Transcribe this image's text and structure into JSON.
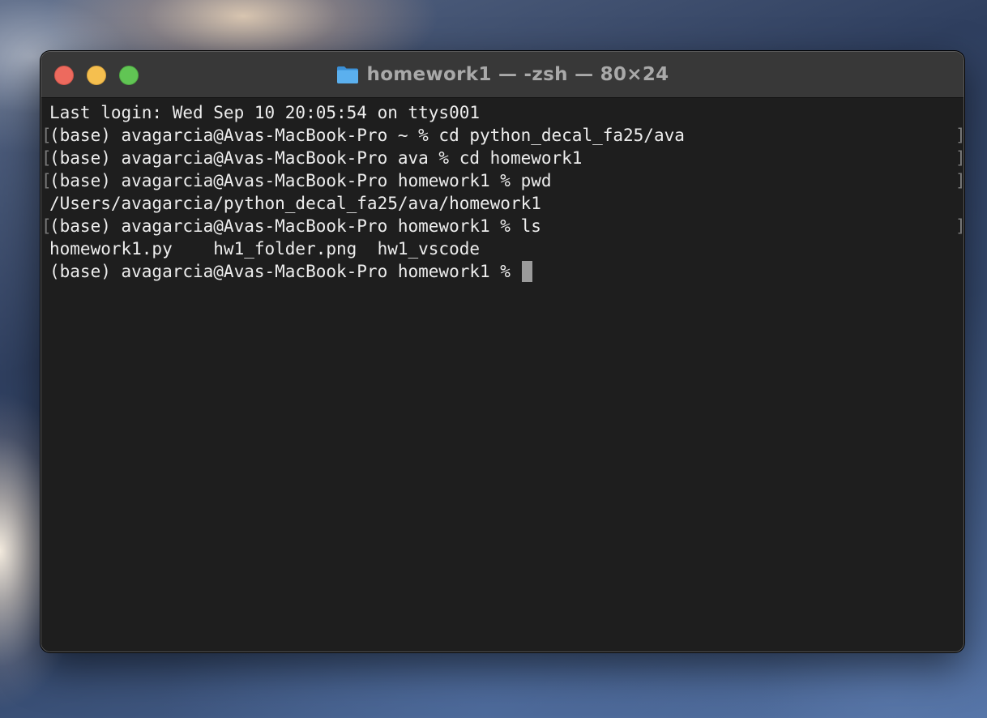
{
  "window": {
    "title": "homework1 — -zsh — 80×24",
    "title_icon": "folder-icon",
    "traffic_lights": {
      "close_color": "#ed6a5e",
      "minimize_color": "#f5bf4f",
      "maximize_color": "#61c554"
    }
  },
  "terminal": {
    "background": "#1e1e1e",
    "foreground": "#ededed",
    "lines": [
      {
        "text": "Last login: Wed Sep 10 20:05:54 on ttys001",
        "marked": false
      },
      {
        "text": "(base) avagarcia@Avas-MacBook-Pro ~ % cd python_decal_fa25/ava",
        "marked": true
      },
      {
        "text": "(base) avagarcia@Avas-MacBook-Pro ava % cd homework1",
        "marked": true
      },
      {
        "text": "(base) avagarcia@Avas-MacBook-Pro homework1 % pwd",
        "marked": true
      },
      {
        "text": "/Users/avagarcia/python_decal_fa25/ava/homework1",
        "marked": false
      },
      {
        "text": "(base) avagarcia@Avas-MacBook-Pro homework1 % ls",
        "marked": true
      },
      {
        "text": "homework1.py    hw1_folder.png  hw1_vscode",
        "marked": false
      },
      {
        "text": "(base) avagarcia@Avas-MacBook-Pro homework1 % ",
        "marked": false,
        "cursor": true
      }
    ]
  }
}
